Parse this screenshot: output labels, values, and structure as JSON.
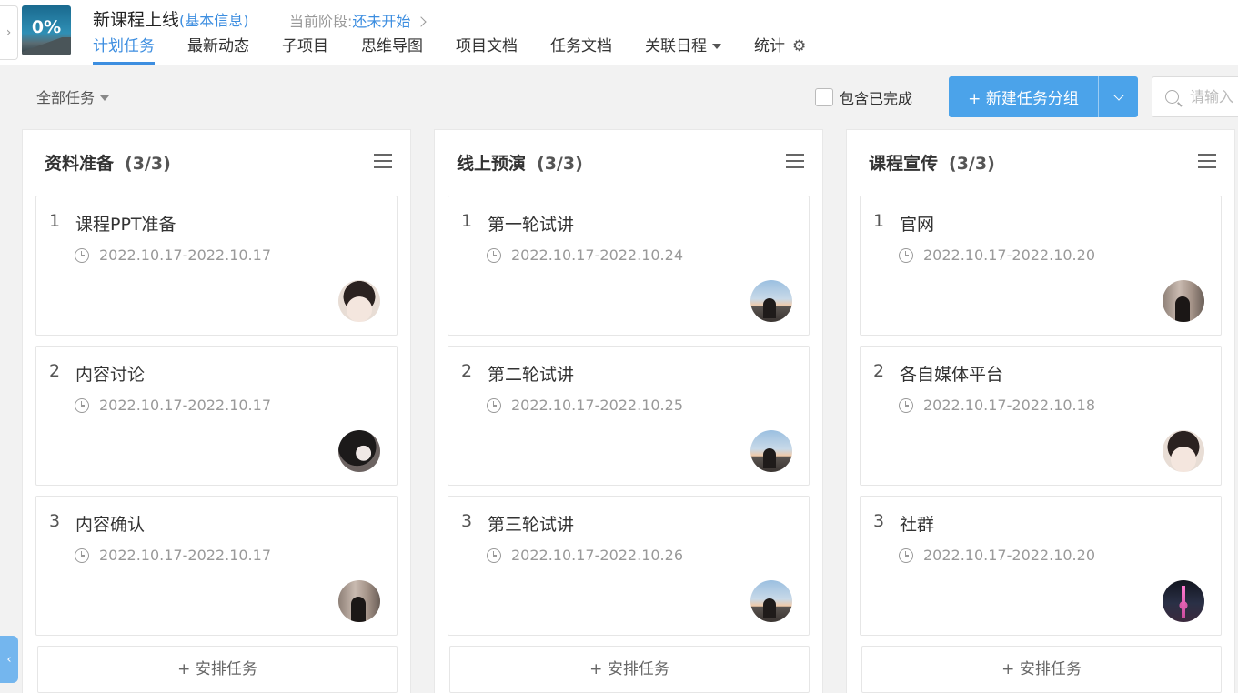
{
  "header": {
    "progress": "0%",
    "project_title": "新课程上线",
    "info_link": "(基本信息)",
    "stage_label": "当前阶段:",
    "stage_value": "还未开始",
    "tabs": [
      {
        "label": "计划任务"
      },
      {
        "label": "最新动态"
      },
      {
        "label": "子项目"
      },
      {
        "label": "思维导图"
      },
      {
        "label": "项目文档"
      },
      {
        "label": "任务文档"
      },
      {
        "label": "关联日程"
      },
      {
        "label": "统计"
      }
    ]
  },
  "toolbar": {
    "filter": "全部任务",
    "include_completed": "包含已完成",
    "new_group": "+ 新建任务分组",
    "search_placeholder": "请输入"
  },
  "columns": [
    {
      "title": "资料准备",
      "count": "(3/3)",
      "cards": [
        {
          "num": "1",
          "name": "课程PPT准备",
          "date": "2022.10.17-2022.10.17",
          "avatar": "girl"
        },
        {
          "num": "2",
          "name": "内容讨论",
          "date": "2022.10.17-2022.10.17",
          "avatar": "dark"
        },
        {
          "num": "3",
          "name": "内容确认",
          "date": "2022.10.17-2022.10.17",
          "avatar": "room"
        }
      ],
      "add_label": "+ 安排任务"
    },
    {
      "title": "线上预演",
      "count": "(3/3)",
      "cards": [
        {
          "num": "1",
          "name": "第一轮试讲",
          "date": "2022.10.17-2022.10.24",
          "avatar": "sky"
        },
        {
          "num": "2",
          "name": "第二轮试讲",
          "date": "2022.10.17-2022.10.25",
          "avatar": "sky"
        },
        {
          "num": "3",
          "name": "第三轮试讲",
          "date": "2022.10.17-2022.10.26",
          "avatar": "sky"
        }
      ],
      "add_label": "+ 安排任务"
    },
    {
      "title": "课程宣传",
      "count": "(3/3)",
      "cards": [
        {
          "num": "1",
          "name": "官网",
          "date": "2022.10.17-2022.10.20",
          "avatar": "room"
        },
        {
          "num": "2",
          "name": "各自媒体平台",
          "date": "2022.10.17-2022.10.18",
          "avatar": "girl"
        },
        {
          "num": "3",
          "name": "社群",
          "date": "2022.10.17-2022.10.20",
          "avatar": "tower"
        }
      ],
      "add_label": "+ 安排任务"
    }
  ],
  "colors": {
    "accent": "#3d8ee0",
    "primary_button": "#4ba3ea",
    "background": "#f2f2f2"
  }
}
